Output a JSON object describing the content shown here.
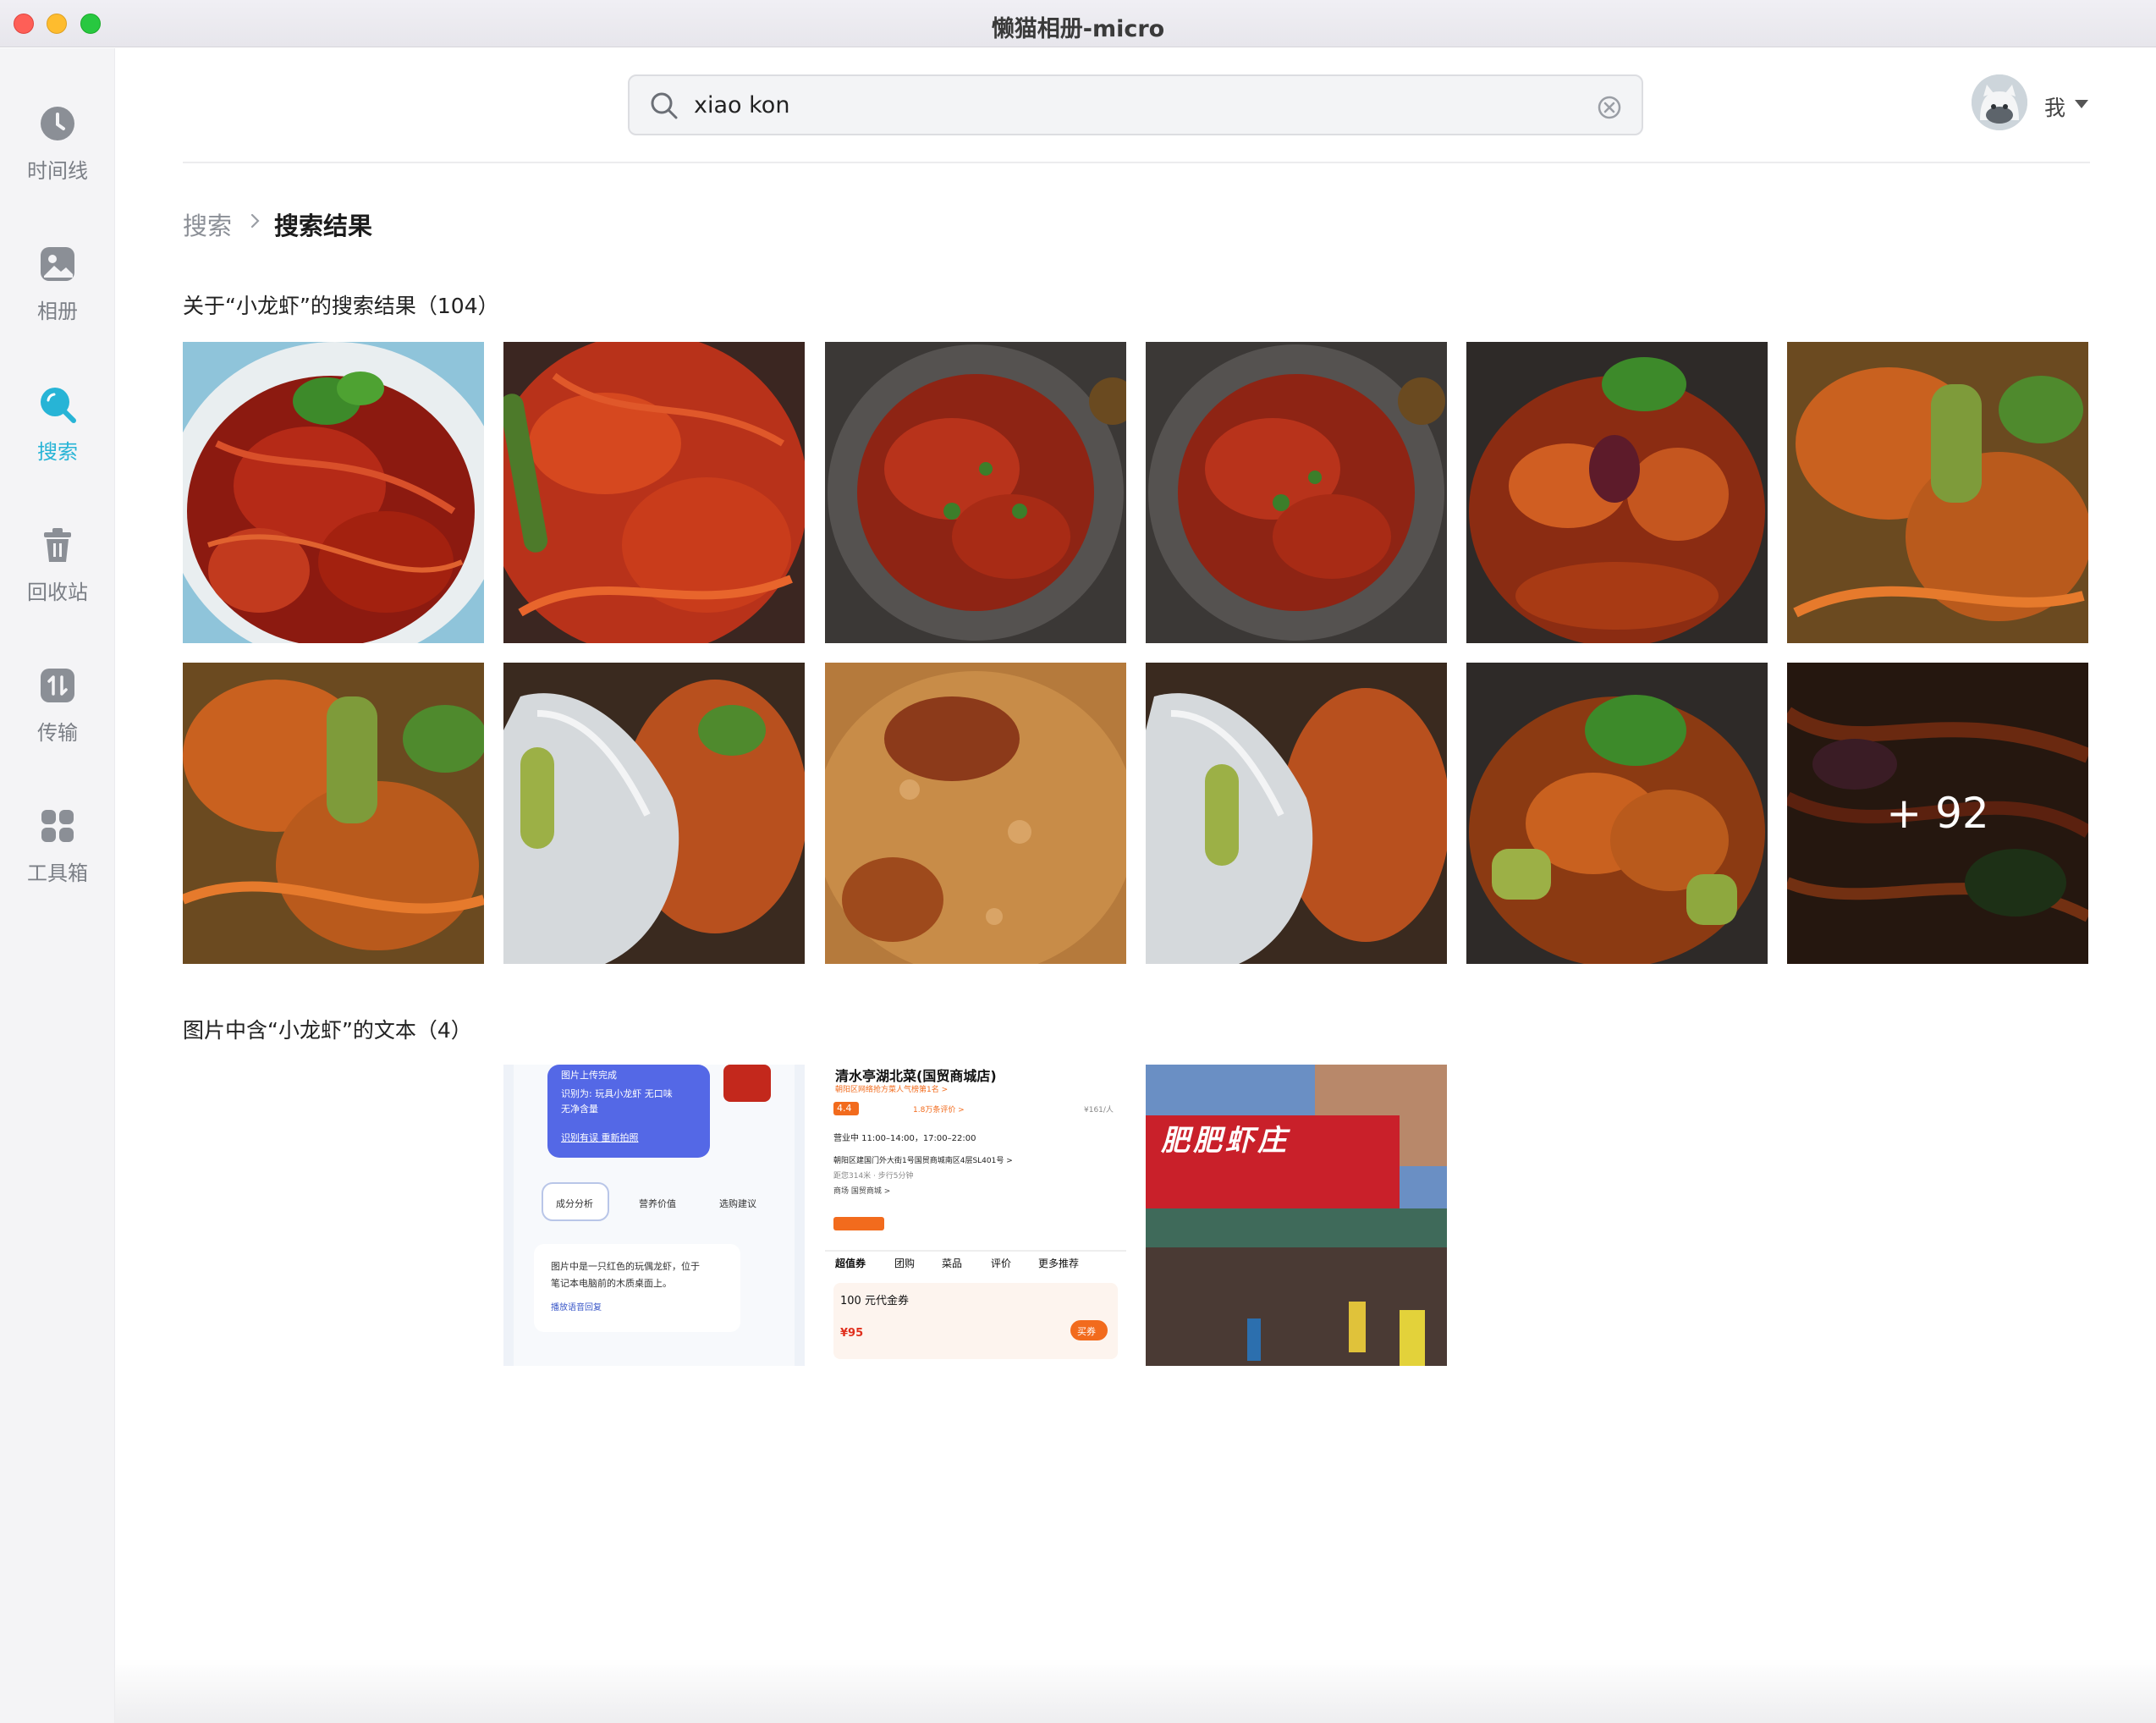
{
  "window": {
    "title": "懒猫相册-micro"
  },
  "sidebar": {
    "items": [
      {
        "label": "时间线",
        "icon": "clock-icon"
      },
      {
        "label": "相册",
        "icon": "album-icon"
      },
      {
        "label": "搜索",
        "icon": "search-icon",
        "active": true
      },
      {
        "label": "回收站",
        "icon": "trash-icon"
      },
      {
        "label": "传输",
        "icon": "transfer-icon"
      },
      {
        "label": "工具箱",
        "icon": "toolbox-icon"
      }
    ],
    "active_color": "#27b4d6"
  },
  "search": {
    "value": "xiao kon"
  },
  "user": {
    "name": "我"
  },
  "breadcrumb": {
    "root": "搜索",
    "current": "搜索结果"
  },
  "results": {
    "title": "关于“小龙虾”的搜索结果（104）",
    "more_label": "+ 92"
  },
  "text_results": {
    "title": "图片中含“小龙虾”的文本（4）",
    "card1": {
      "upload_done": "图片上传完成",
      "recognized": "识别为: 玩具小龙虾 无口味",
      "no_content": "无净含量",
      "retake": "识别有误 重新拍照",
      "tab1": "成分分析",
      "tab2": "营养价值",
      "tab3": "选购建议",
      "desc1": "图片中是一只红色的玩偶龙虾，位于",
      "desc2": "笔记本电脑前的木质桌面上。",
      "play": "播放语音回复"
    },
    "card2": {
      "shop": "清水亭湖北菜(国贸商城店)",
      "rank": "朝阳区网络抢方菜人气榜第1名 >",
      "rating": "4.4",
      "reviews": "1.8万条评价 >",
      "price": "¥161/人",
      "hours": "营业中 11:00–14:00，17:00–22:00",
      "address": "朝阳区建国门外大街1号国贸商城南区4层SL401号 >",
      "distance": "距您314米 · 步行5分钟",
      "mall": "商场 国贸商城 >",
      "tabs": [
        "超值券",
        "团购",
        "菜品",
        "评价",
        "更多推荐"
      ],
      "coupon": "100 元代金券",
      "coupon_price": "¥95",
      "buy": "买券"
    },
    "card3": {
      "sign": "肥肥虾庄"
    }
  }
}
